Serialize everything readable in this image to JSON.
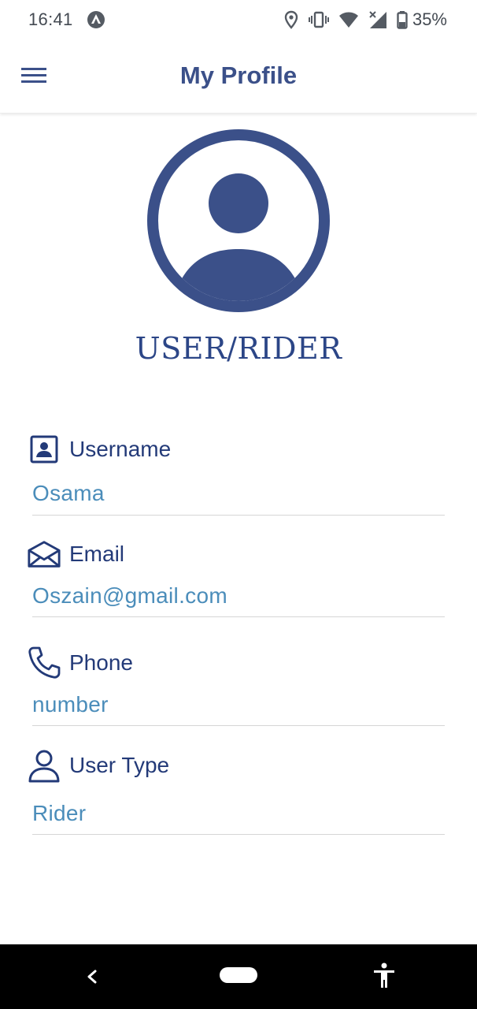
{
  "status_bar": {
    "time": "16:41",
    "battery_percent": "35%",
    "icons": [
      "app-notification-icon",
      "location-icon",
      "vibrate-icon",
      "wifi-icon",
      "signal-icon",
      "battery-icon"
    ]
  },
  "header": {
    "title": "My Profile",
    "menu_icon": "hamburger-menu-icon"
  },
  "profile": {
    "avatar_icon": "user-avatar-icon",
    "role_title": "USER/RIDER"
  },
  "fields": {
    "username": {
      "label": "Username",
      "value": "Osama",
      "icon": "contact-card-icon"
    },
    "email": {
      "label": "Email",
      "value": "Oszain@gmail.com",
      "icon": "envelope-icon"
    },
    "phone": {
      "label": "Phone",
      "value": "number",
      "icon": "phone-icon"
    },
    "user_type": {
      "label": "User Type",
      "value": "Rider",
      "icon": "person-icon"
    }
  },
  "nav_bar": {
    "icons": [
      "back-icon",
      "home-pill-icon",
      "accessibility-icon"
    ]
  },
  "colors": {
    "primary": "#3b5089",
    "label": "#233a78",
    "value": "#4b8dba",
    "divider": "#d6d6d6"
  }
}
